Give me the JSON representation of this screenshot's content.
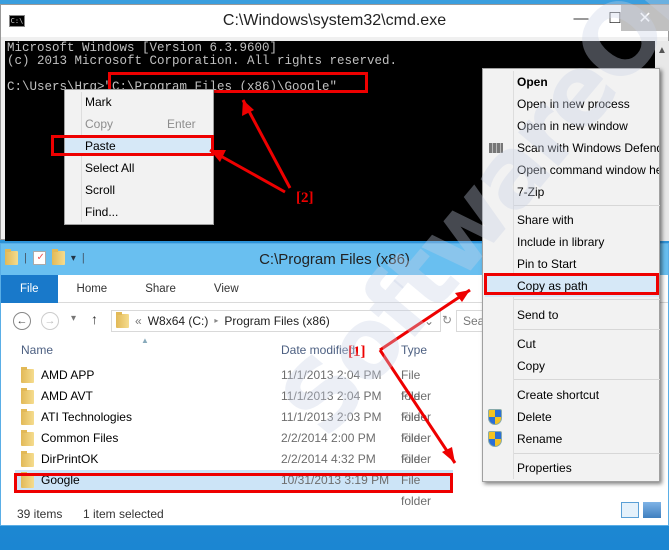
{
  "cmd": {
    "title": "C:\\Windows\\system32\\cmd.exe",
    "icon_label": "C:\\",
    "minimize": "—",
    "maximize": "☐",
    "close": "✕",
    "scroll_up": "▲",
    "lines": [
      "Microsoft Windows [Version 6.3.9600]",
      "(c) 2013 Microsoft Corporation. All rights reserved.",
      "",
      "C:\\Users\\Hrg>\"C:\\Program Files (x86)\\Google\""
    ],
    "context_menu": [
      {
        "label": "Mark"
      },
      {
        "label": "Copy",
        "accel": "Enter",
        "disabled": true
      },
      {
        "label": "Paste",
        "highlighted": true
      },
      {
        "label": "Select All"
      },
      {
        "label": "Scroll"
      },
      {
        "label": "Find..."
      }
    ]
  },
  "explorer": {
    "title": "C:\\Program Files (x86)",
    "tabs": [
      "File",
      "Home",
      "Share",
      "View"
    ],
    "nav": {
      "back": "←",
      "forward": "→",
      "recent": "▾",
      "up": "↑"
    },
    "address": {
      "overflow": "«",
      "segments": [
        "W8x64 (C:)",
        "Program Files (x86)"
      ],
      "sep": "▸",
      "dropdown": "⌄",
      "refresh": "↻"
    },
    "search_placeholder": "Sea",
    "columns": {
      "name": "Name",
      "date": "Date modified",
      "type": "Type"
    },
    "rows": [
      {
        "name": "AMD APP",
        "date": "11/1/2013 2:04 PM",
        "type": "File folder"
      },
      {
        "name": "AMD AVT",
        "date": "11/1/2013 2:04 PM",
        "type": "File folder"
      },
      {
        "name": "ATI Technologies",
        "date": "11/1/2013 2:03 PM",
        "type": "File folder"
      },
      {
        "name": "Common Files",
        "date": "2/2/2014 2:00 PM",
        "type": "File folder"
      },
      {
        "name": "DirPrintOK",
        "date": "2/2/2014 4:32 PM",
        "type": "File folder"
      },
      {
        "name": "Google",
        "date": "10/31/2013 3:19 PM",
        "type": "File folder",
        "selected": true
      }
    ],
    "status": {
      "count": "39 items",
      "selected": "1 item selected"
    }
  },
  "explorer_context_menu": [
    {
      "label": "Open",
      "bold": true
    },
    {
      "label": "Open in new process"
    },
    {
      "label": "Open in new window"
    },
    {
      "label": "Scan with Windows Defender...",
      "icon": "defender-icon"
    },
    {
      "label": "Open command window here"
    },
    {
      "label": "7-Zip"
    },
    {
      "label": "Share with"
    },
    {
      "label": "Include in library"
    },
    {
      "label": "Pin to Start"
    },
    {
      "label": "Copy as path",
      "highlighted": true
    },
    {
      "label": "Send to"
    },
    {
      "label": "Cut"
    },
    {
      "label": "Copy"
    },
    {
      "label": "Create shortcut"
    },
    {
      "label": "Delete",
      "icon": "shield-icon"
    },
    {
      "label": "Rename",
      "icon": "shield-icon"
    },
    {
      "label": "Properties"
    }
  ],
  "annotations": {
    "step1": "[1]",
    "step2": "[2]"
  },
  "watermark": "SoftwareOK.com",
  "colors": {
    "highlight": "#e00000",
    "selection": "#cce4f7",
    "ribbon_file": "#1979ca",
    "title_bar": "#69bff0"
  }
}
